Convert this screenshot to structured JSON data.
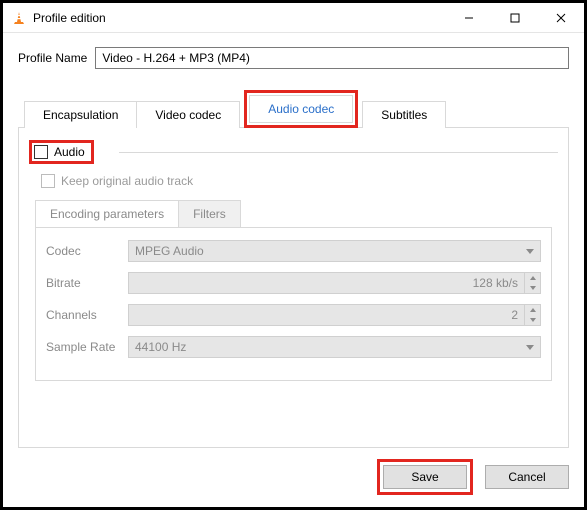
{
  "window": {
    "title": "Profile edition"
  },
  "profile": {
    "label": "Profile Name",
    "value": "Video - H.264 + MP3 (MP4)"
  },
  "tabs": {
    "encapsulation": "Encapsulation",
    "video": "Video codec",
    "audio": "Audio codec",
    "subtitles": "Subtitles"
  },
  "audio_group": {
    "label": "Audio",
    "keep_original": "Keep original audio track"
  },
  "subtabs": {
    "encoding": "Encoding parameters",
    "filters": "Filters"
  },
  "fields": {
    "codec": {
      "label": "Codec",
      "value": "MPEG Audio"
    },
    "bitrate": {
      "label": "Bitrate",
      "value": "128 kb/s"
    },
    "channels": {
      "label": "Channels",
      "value": "2"
    },
    "samplerate": {
      "label": "Sample Rate",
      "value": "44100 Hz"
    }
  },
  "buttons": {
    "save": "Save",
    "cancel": "Cancel"
  }
}
